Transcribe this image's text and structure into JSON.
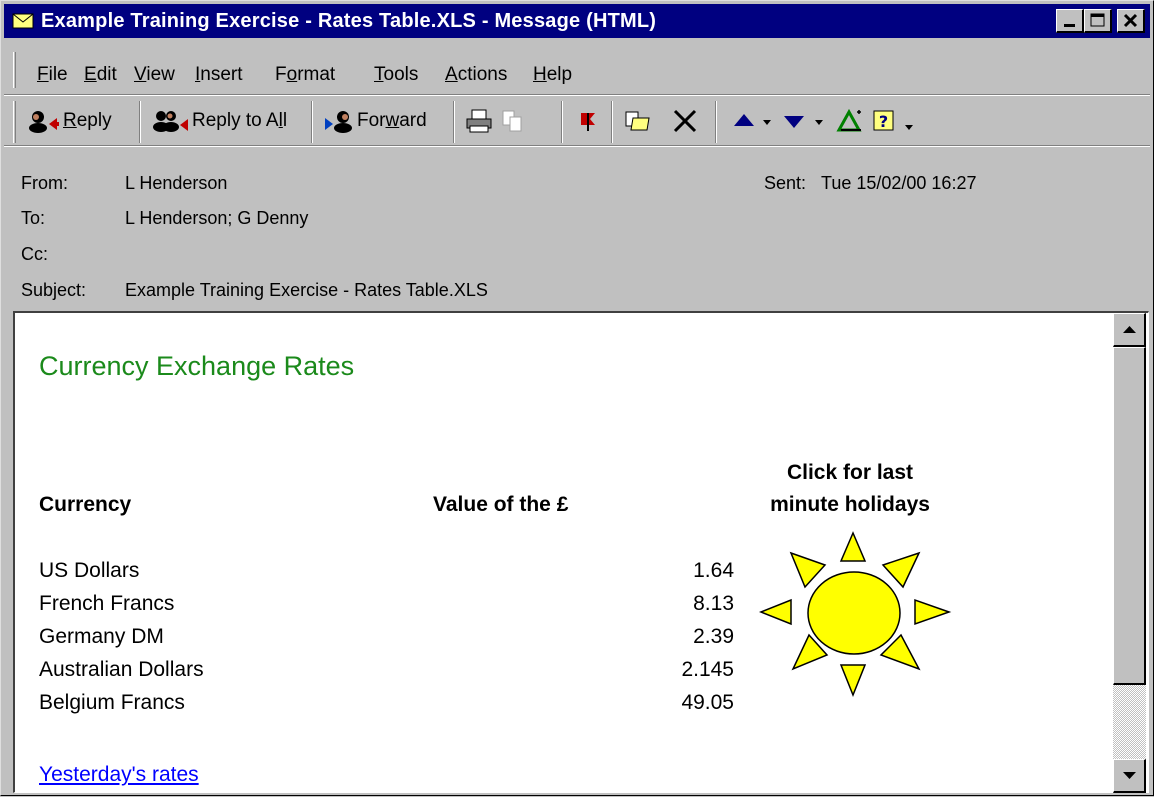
{
  "window": {
    "title": "Example Training Exercise - Rates Table.XLS - Message (HTML)"
  },
  "menu": [
    {
      "pre": "",
      "key": "F",
      "post": "ile"
    },
    {
      "pre": "",
      "key": "E",
      "post": "dit"
    },
    {
      "pre": "",
      "key": "V",
      "post": "iew"
    },
    {
      "pre": "",
      "key": "I",
      "post": "nsert"
    },
    {
      "pre": "F",
      "key": "o",
      "post": "rmat"
    },
    {
      "pre": "",
      "key": "T",
      "post": "ools"
    },
    {
      "pre": "",
      "key": "A",
      "post": "ctions"
    },
    {
      "pre": "",
      "key": "H",
      "post": "elp"
    }
  ],
  "toolbar": {
    "reply": {
      "pre": "",
      "key": "R",
      "post": "eply"
    },
    "reply_all": {
      "pre": "Reply to A",
      "key": "l",
      "post": "l"
    },
    "forward": {
      "pre": "For",
      "key": "w",
      "post": "ard"
    }
  },
  "header": {
    "from_label": "From:",
    "from_value": "L Henderson",
    "sent_label": "Sent:",
    "sent_value": "Tue 15/02/00 16:27",
    "to_label": "To:",
    "to_value": "L Henderson; G Denny",
    "cc_label": "Cc:",
    "cc_value": "",
    "subject_label": "Subject:",
    "subject_value": "Example Training Exercise - Rates Table.XLS"
  },
  "content": {
    "title": "Currency Exchange Rates",
    "currency_header": "Currency",
    "value_header": "Value of the £",
    "promo_line1": "Click for last",
    "promo_line2": "minute holidays",
    "rates": [
      {
        "name": "US Dollars",
        "value": "1.64"
      },
      {
        "name": "French Francs",
        "value": "8.13"
      },
      {
        "name": "Germany DM",
        "value": "2.39"
      },
      {
        "name": "Australian Dollars",
        "value": "2.145"
      },
      {
        "name": "Belgium Francs",
        "value": "49.05"
      }
    ],
    "link": "Yesterday's rates"
  },
  "colors": {
    "titlebar": "#000080",
    "heading_green": "#1b8a1b",
    "link_blue": "#0000ff",
    "sun_yellow": "#ffff00"
  }
}
